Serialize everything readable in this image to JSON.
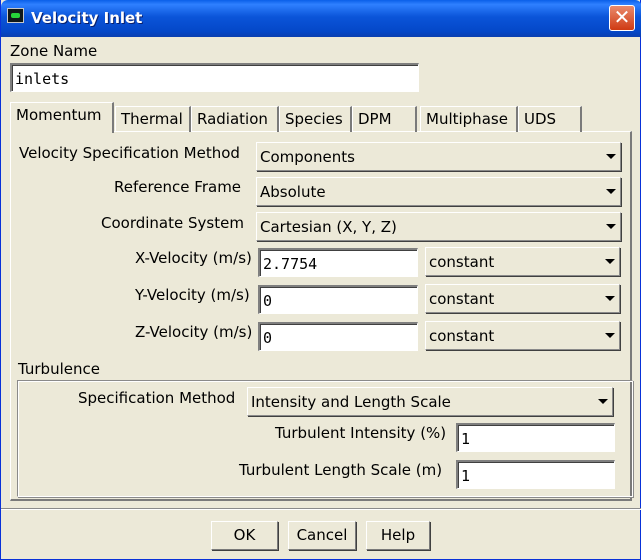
{
  "window": {
    "title": "Velocity Inlet"
  },
  "zone": {
    "label": "Zone Name",
    "value": "inlets"
  },
  "tabs": [
    {
      "label": "Momentum",
      "active": true
    },
    {
      "label": "Thermal",
      "active": false
    },
    {
      "label": "Radiation",
      "active": false
    },
    {
      "label": "Species",
      "active": false
    },
    {
      "label": "DPM",
      "active": false
    },
    {
      "label": "Multiphase",
      "active": false
    },
    {
      "label": "UDS",
      "active": false
    }
  ],
  "momentum": {
    "velocity_spec_label": "Velocity Specification Method",
    "velocity_spec_value": "Components",
    "reference_frame_label": "Reference Frame",
    "reference_frame_value": "Absolute",
    "coordinate_system_label": "Coordinate System",
    "coordinate_system_value": "Cartesian (X, Y, Z)",
    "x_velocity_label": "X-Velocity (m/s)",
    "x_velocity_value": "2.7754",
    "x_velocity_profile": "constant",
    "y_velocity_label": "Y-Velocity (m/s)",
    "y_velocity_value": "0",
    "y_velocity_profile": "constant",
    "z_velocity_label": "Z-Velocity (m/s)",
    "z_velocity_value": "0",
    "z_velocity_profile": "constant"
  },
  "turbulence": {
    "heading": "Turbulence",
    "spec_method_label": "Specification Method",
    "spec_method_value": "Intensity and Length Scale",
    "intensity_label": "Turbulent Intensity (%)",
    "intensity_value": "1",
    "length_scale_label": "Turbulent Length Scale (m)",
    "length_scale_value": "1"
  },
  "buttons": {
    "ok": "OK",
    "cancel": "Cancel",
    "help": "Help"
  },
  "colors": {
    "titlebar": "#0b55d9",
    "dialog_bg": "#ece9d8",
    "close_button": "#cf3a13"
  },
  "icons": {
    "window": "fluent-app-icon",
    "close": "close-x-icon",
    "dropdown": "chevron-down-icon"
  }
}
